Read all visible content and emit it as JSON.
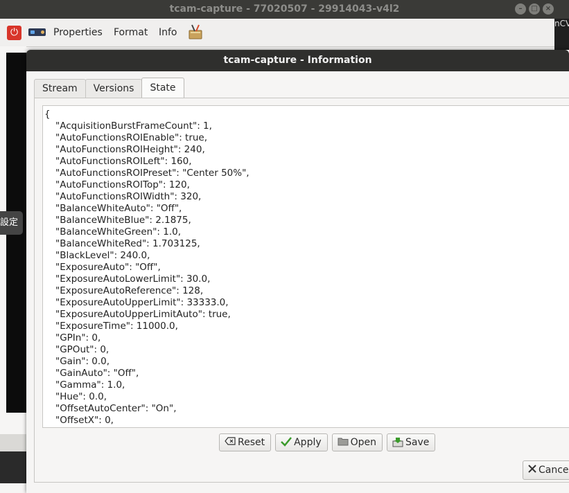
{
  "main_window": {
    "title": "tcam-capture - 77020507 - 29914043-v4l2",
    "controls": [
      "–",
      "□",
      "×"
    ]
  },
  "menubar": {
    "items": [
      "Properties",
      "Format",
      "Info"
    ]
  },
  "background": {
    "side_label": "設定",
    "right_text": "nCV"
  },
  "dialog": {
    "title": "tcam-capture - Information",
    "tabs": [
      "Stream",
      "Versions",
      "State"
    ],
    "active_tab": "State",
    "state_json_open": "{",
    "state_lines": [
      "\"AcquisitionBurstFrameCount\": 1,",
      "\"AutoFunctionsROIEnable\": true,",
      "\"AutoFunctionsROIHeight\": 240,",
      "\"AutoFunctionsROILeft\": 160,",
      "\"AutoFunctionsROIPreset\": \"Center 50%\",",
      "\"AutoFunctionsROITop\": 120,",
      "\"AutoFunctionsROIWidth\": 320,",
      "\"BalanceWhiteAuto\": \"Off\",",
      "\"BalanceWhiteBlue\": 2.1875,",
      "\"BalanceWhiteGreen\": 1.0,",
      "\"BalanceWhiteRed\": 1.703125,",
      "\"BlackLevel\": 240.0,",
      "\"ExposureAuto\": \"Off\",",
      "\"ExposureAutoLowerLimit\": 30.0,",
      "\"ExposureAutoReference\": 128,",
      "\"ExposureAutoUpperLimit\": 33333.0,",
      "\"ExposureAutoUpperLimitAuto\": true,",
      "\"ExposureTime\": 11000.0,",
      "\"GPIn\": 0,",
      "\"GPOut\": 0,",
      "\"Gain\": 0.0,",
      "\"GainAuto\": \"Off\",",
      "\"Gamma\": 1.0,",
      "\"Hue\": 0.0,",
      "\"OffsetAutoCenter\": \"On\",",
      "\"OffsetX\": 0,"
    ],
    "buttons": {
      "reset": "Reset",
      "apply": "Apply",
      "open": "Open",
      "save": "Save"
    },
    "cancel_label": "Cancel"
  },
  "colors": {
    "titlebar_bg": "#3a3a37",
    "dialog_titlebar_bg": "#2f2f2d",
    "power_red": "#d8352a",
    "apply_check_green": "#3a9a2a"
  }
}
